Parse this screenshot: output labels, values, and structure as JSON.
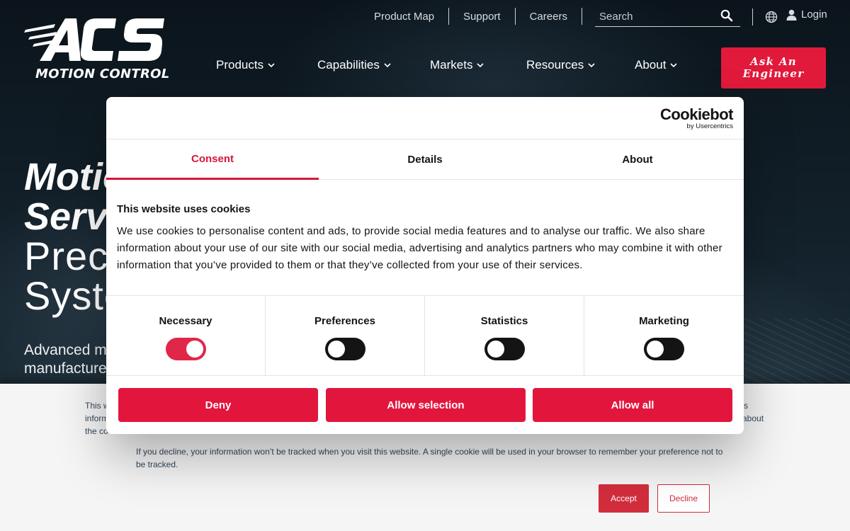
{
  "header": {
    "logo_text": "MOTION CONTROL",
    "utility_links": [
      "Product Map",
      "Support",
      "Careers"
    ],
    "search_placeholder": "Search",
    "login_label": "Login",
    "nav": [
      "Products",
      "Capabilities",
      "Markets",
      "Resources",
      "About"
    ],
    "cta_line1": "Ask An",
    "cta_line2": "Engineer"
  },
  "hero": {
    "line1": "Motion Control &",
    "line2": "Servo Drives for",
    "line3": "Precision Motion",
    "line4": "Systems",
    "sub1": "Advanced motion control solutions for",
    "sub2": "manufacturers of precision equipment"
  },
  "cookie_dialog": {
    "brand": "Cookiebot",
    "brand_by": "by Usercentrics",
    "tabs": [
      "Consent",
      "Details",
      "About"
    ],
    "active_tab": "Consent",
    "title": "This website uses cookies",
    "body": "We use cookies to personalise content and ads, to provide social media features and to analyse our traffic. We also share information about your use of our site with our social media, advertising and analytics partners who may combine it with other information that you’ve provided to them or that they’ve collected from your use of their services.",
    "categories": [
      {
        "label": "Necessary",
        "enabled": true
      },
      {
        "label": "Preferences",
        "enabled": false
      },
      {
        "label": "Statistics",
        "enabled": false
      },
      {
        "label": "Marketing",
        "enabled": false
      }
    ],
    "buttons": [
      "Deny",
      "Allow selection",
      "Allow all"
    ]
  },
  "bottom_banner": {
    "text1_left_a": "This w",
    "text1_left_b": "inform",
    "text1_left_c": "the co",
    "text1_right_a": "s",
    "text1_right_b": "about",
    "text2": "If you decline, your information won’t be tracked when you visit this website. A single cookie will be used in your browser to remember your preference not to be tracked.",
    "accept": "Accept",
    "decline": "Decline"
  },
  "colors": {
    "brand_red": "#e11a3b",
    "cookiebot_red": "#e2163d",
    "hubspot_red": "#d22d3d"
  }
}
